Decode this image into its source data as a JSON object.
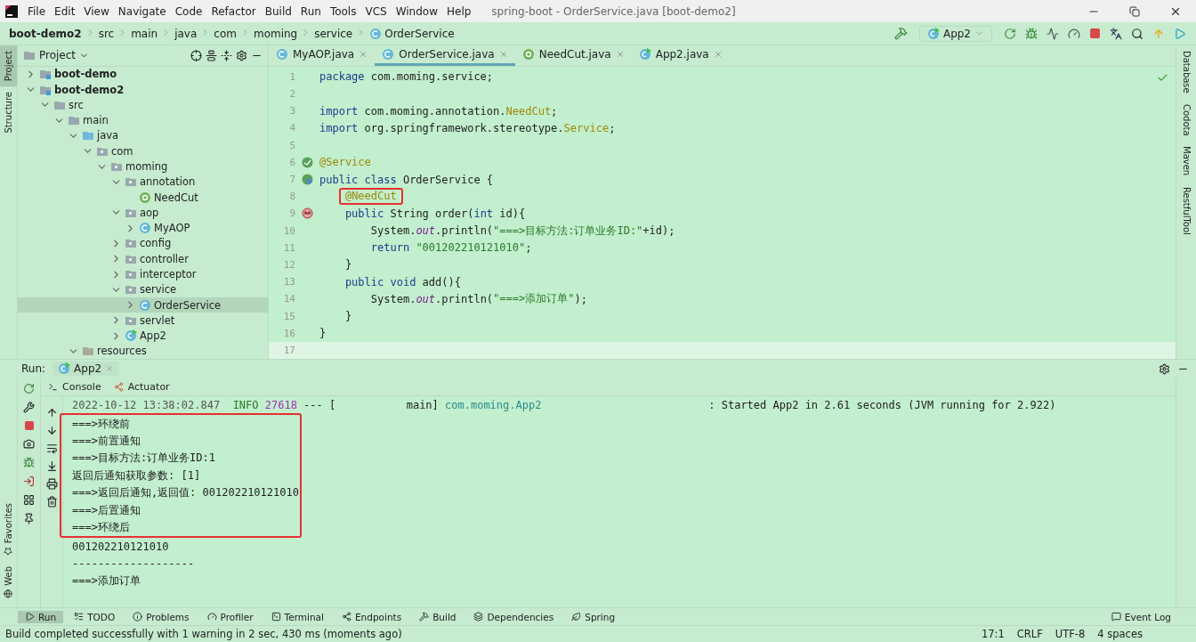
{
  "menu_bar": {
    "items": [
      "File",
      "Edit",
      "View",
      "Navigate",
      "Code",
      "Refactor",
      "Build",
      "Run",
      "Tools",
      "VCS",
      "Window",
      "Help"
    ],
    "title": "spring-boot - OrderService.java [boot-demo2]"
  },
  "breadcrumbs": [
    {
      "label": "boot-demo2",
      "kind": "project"
    },
    {
      "label": "src",
      "kind": "folder"
    },
    {
      "label": "main",
      "kind": "folder"
    },
    {
      "label": "java",
      "kind": "folder"
    },
    {
      "label": "com",
      "kind": "folder"
    },
    {
      "label": "moming",
      "kind": "folder"
    },
    {
      "label": "service",
      "kind": "folder"
    },
    {
      "label": "OrderService",
      "kind": "class"
    }
  ],
  "run_config": {
    "label": "App2"
  },
  "left_stripe": {
    "top": [
      {
        "label": "Project",
        "selected": true
      },
      {
        "label": "Structure",
        "selected": false
      }
    ],
    "bottom": [
      "Favorites",
      "Web"
    ]
  },
  "right_stripe": [
    "Database",
    "Codota",
    "Maven",
    "RestfulTool"
  ],
  "project_panel": {
    "title": "Project",
    "tree": [
      {
        "label": "boot-demo",
        "kind": "module",
        "expanded": false,
        "selected": false
      },
      {
        "label": "boot-demo2",
        "kind": "module",
        "expanded": true,
        "selected": false,
        "children": [
          {
            "label": "src",
            "kind": "folder",
            "expanded": true,
            "selected": false,
            "children": [
              {
                "label": "main",
                "kind": "folder",
                "expanded": true,
                "selected": false,
                "children": [
                  {
                    "label": "java",
                    "kind": "source",
                    "expanded": true,
                    "selected": false,
                    "children": [
                      {
                        "label": "com",
                        "kind": "package",
                        "expanded": true,
                        "selected": false,
                        "children": [
                          {
                            "label": "moming",
                            "kind": "package",
                            "expanded": true,
                            "selected": false,
                            "children": [
                              {
                                "label": "annotation",
                                "kind": "package",
                                "expanded": true,
                                "selected": false,
                                "children": [
                                  {
                                    "label": "NeedCut",
                                    "kind": "annotation",
                                    "selected": false
                                  }
                                ]
                              },
                              {
                                "label": "aop",
                                "kind": "package",
                                "expanded": true,
                                "selected": false,
                                "children": [
                                  {
                                    "label": "MyAOP",
                                    "kind": "class",
                                    "expanded": false,
                                    "selected": false
                                  }
                                ]
                              },
                              {
                                "label": "config",
                                "kind": "package",
                                "expanded": false,
                                "selected": false
                              },
                              {
                                "label": "controller",
                                "kind": "package",
                                "expanded": false,
                                "selected": false
                              },
                              {
                                "label": "interceptor",
                                "kind": "package",
                                "expanded": false,
                                "selected": false
                              },
                              {
                                "label": "service",
                                "kind": "package",
                                "expanded": true,
                                "selected": false,
                                "children": [
                                  {
                                    "label": "OrderService",
                                    "kind": "class",
                                    "expanded": false,
                                    "selected": true
                                  }
                                ]
                              },
                              {
                                "label": "servlet",
                                "kind": "package",
                                "expanded": false,
                                "selected": false
                              },
                              {
                                "label": "App2",
                                "kind": "boot",
                                "expanded": false,
                                "selected": false
                              }
                            ]
                          }
                        ]
                      }
                    ]
                  },
                  {
                    "label": "resources",
                    "kind": "resources",
                    "expanded": true,
                    "selected": false
                  }
                ]
              }
            ]
          }
        ]
      }
    ]
  },
  "editor_tabs": [
    {
      "label": "MyAOP.java",
      "kind": "class",
      "selected": false
    },
    {
      "label": "OrderService.java",
      "kind": "class",
      "selected": true
    },
    {
      "label": "NeedCut.java",
      "kind": "annotation",
      "selected": false
    },
    {
      "label": "App2.java",
      "kind": "boot",
      "selected": false
    }
  ],
  "editor": {
    "lines": [
      {
        "number": "1",
        "tokens": [
          {
            "text": "package ",
            "kind": "kw"
          },
          {
            "text": "com.moming.service;",
            "kind": "plain"
          }
        ]
      },
      {
        "number": "2"
      },
      {
        "number": "3",
        "tokens": [
          {
            "text": "import ",
            "kind": "kw"
          },
          {
            "text": "com.moming.annotation.",
            "kind": "plain"
          },
          {
            "text": "NeedCut",
            "kind": "ann"
          },
          {
            "text": ";",
            "kind": "plain"
          }
        ]
      },
      {
        "number": "4",
        "tokens": [
          {
            "text": "import ",
            "kind": "kw"
          },
          {
            "text": "org.springframework.stereotype.",
            "kind": "plain"
          },
          {
            "text": "Service",
            "kind": "ann"
          },
          {
            "text": ";",
            "kind": "plain"
          }
        ]
      },
      {
        "number": "5"
      },
      {
        "number": "6",
        "kind": "bean",
        "tokens": [
          {
            "text": "@Service",
            "kind": "ann"
          }
        ]
      },
      {
        "number": "7",
        "kind": "spring",
        "tokens": [
          {
            "text": "public class ",
            "kind": "kw"
          },
          {
            "text": "OrderService {",
            "kind": "plain"
          }
        ]
      },
      {
        "number": "8",
        "tokens": [
          {
            "text": "    @NeedCut",
            "kind": "ann",
            "boxed": true
          }
        ]
      },
      {
        "number": "9",
        "kind": "method",
        "tokens": [
          {
            "text": "    public ",
            "kind": "kw"
          },
          {
            "text": "String order(",
            "kind": "plain"
          },
          {
            "text": "int ",
            "kind": "kw"
          },
          {
            "text": "id){",
            "kind": "plain"
          }
        ]
      },
      {
        "number": "10",
        "tokens": [
          {
            "text": "        System.",
            "kind": "plain"
          },
          {
            "text": "out",
            "kind": "static"
          },
          {
            "text": ".println(",
            "kind": "plain"
          },
          {
            "text": "\"===>目标方法:订单业务ID:\"",
            "kind": "str"
          },
          {
            "text": "+id);",
            "kind": "plain"
          }
        ]
      },
      {
        "number": "11",
        "tokens": [
          {
            "text": "        return ",
            "kind": "kw"
          },
          {
            "text": "\"001202210121010\"",
            "kind": "str"
          },
          {
            "text": ";",
            "kind": "plain"
          }
        ]
      },
      {
        "number": "12",
        "tokens": [
          {
            "text": "    }",
            "kind": "plain"
          }
        ]
      },
      {
        "number": "13",
        "tokens": [
          {
            "text": "    public void ",
            "kind": "kw"
          },
          {
            "text": "add(){",
            "kind": "plain"
          }
        ]
      },
      {
        "number": "14",
        "tokens": [
          {
            "text": "        System.",
            "kind": "plain"
          },
          {
            "text": "out",
            "kind": "static"
          },
          {
            "text": ".println(",
            "kind": "plain"
          },
          {
            "text": "\"===>添加订单\"",
            "kind": "str"
          },
          {
            "text": ");",
            "kind": "plain"
          }
        ]
      },
      {
        "number": "15",
        "tokens": [
          {
            "text": "    }",
            "kind": "plain"
          }
        ]
      },
      {
        "number": "16",
        "tokens": [
          {
            "text": "}",
            "kind": "plain"
          }
        ]
      },
      {
        "number": "17",
        "current": true
      }
    ]
  },
  "run_panel": {
    "label": "Run:",
    "tab": "App2",
    "subtabs": [
      {
        "label": "Console",
        "kind": "console"
      },
      {
        "label": "Actuator",
        "kind": "actuator"
      }
    ],
    "console": [
      {
        "kind": "line",
        "tokens": [
          {
            "text": "2022-10-12 13:38:02.847  ",
            "kind": "date"
          },
          {
            "text": "INFO ",
            "kind": "info"
          },
          {
            "text": "27618",
            "kind": "pid"
          },
          {
            "text": " --- [           main] ",
            "kind": "plain"
          },
          {
            "text": "com.moming.App2",
            "kind": "logger"
          },
          {
            "text": "                          : Started App2 in 2.61 seconds (JVM running for 2.922)",
            "kind": "plain"
          }
        ]
      },
      {
        "kind": "frame",
        "lines": [
          "===>环绕前",
          "===>前置通知",
          "===>目标方法:订单业务ID:1",
          "返回后通知获取参数: [1]",
          "===>返回后通知,返回值: 001202210121010",
          "===>后置通知",
          "===>环绕后"
        ]
      },
      {
        "kind": "line",
        "tokens": [
          {
            "text": "001202210121010",
            "kind": "plain"
          }
        ]
      },
      {
        "kind": "line",
        "tokens": [
          {
            "text": "-------------------",
            "kind": "plain"
          }
        ]
      },
      {
        "kind": "line",
        "tokens": [
          {
            "text": "===>添加订单",
            "kind": "plain"
          }
        ]
      }
    ]
  },
  "tool_tabs": [
    {
      "label": "Run",
      "kind": "run",
      "selected": true
    },
    {
      "label": "TODO",
      "kind": "todo",
      "selected": false
    },
    {
      "label": "Problems",
      "kind": "problems",
      "selected": false
    },
    {
      "label": "Profiler",
      "kind": "profiler",
      "selected": false
    },
    {
      "label": "Terminal",
      "kind": "terminal",
      "selected": false
    },
    {
      "label": "Endpoints",
      "kind": "endpoints",
      "selected": false
    },
    {
      "label": "Build",
      "kind": "build",
      "selected": false
    },
    {
      "label": "Dependencies",
      "kind": "dependencies",
      "selected": false
    },
    {
      "label": "Spring",
      "kind": "spring",
      "selected": false
    }
  ],
  "event_log": "Event Log",
  "status_bar": {
    "message": "Build completed successfully with 1 warning in 2 sec, 430 ms (moments ago)",
    "items": [
      "17:1",
      "CRLF",
      "UTF-8",
      "4 spaces"
    ]
  }
}
